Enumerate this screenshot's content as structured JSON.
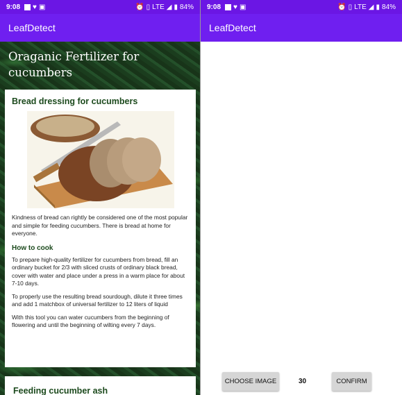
{
  "left_screen": {
    "status": {
      "time": "9:08",
      "battery": "84%",
      "network": "LTE"
    },
    "appbar": {
      "title": "LeafDetect"
    },
    "page_title": "Oraganic Fertilizer for cucumbers",
    "card1": {
      "heading": "Bread dressing for cucumbers",
      "image_alt": "sliced bread loaf with knife on board",
      "intro": "Kindness of bread can rightly be considered one of the most popular and simple for feeding cucumbers. There is bread at home for everyone.",
      "subheading": "How to cook",
      "para1": "To prepare high-quality fertilizer for cucumbers from bread, fill an ordinary bucket for 2/3 with sliced crusts of ordinary black bread, cover with water and place under a press in a warm place for about 7-10 days.",
      "para2": "To properly use the resulting bread sourdough, dilute it three times and add 1 matchbox of universal fertilizer to 12 liters of liquid",
      "para3": "With this tool you can water cucumbers from the beginning of flowering and until the beginning of wilting every 7 days."
    },
    "card2": {
      "heading": "Feeding cucumber ash"
    }
  },
  "right_screen": {
    "status": {
      "time": "9:08",
      "battery": "84%",
      "network": "LTE"
    },
    "appbar": {
      "title": "LeafDetect"
    },
    "choose_button": "CHOOSE IMAGE",
    "count": "30",
    "confirm_button": "CONFIRM"
  },
  "colors": {
    "status_bar": "#6b16e4",
    "app_bar": "#6f1ff0",
    "heading_green": "#1c4a1d",
    "button_gray": "#d6d6d6"
  },
  "icons": [
    "square-icon",
    "heart-icon",
    "photo-icon",
    "alarm-icon",
    "vibrate-icon",
    "signal-icon",
    "battery-icon"
  ]
}
